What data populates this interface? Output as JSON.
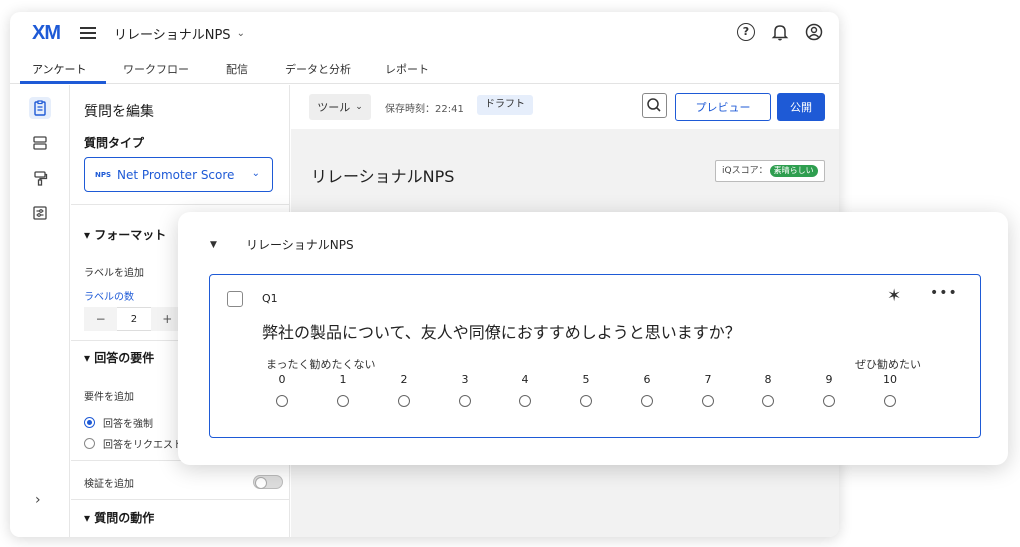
{
  "header": {
    "logo": "XM",
    "project_title": "リレーショナルNPS"
  },
  "nav_tabs": [
    "アンケート",
    "ワークフロー",
    "配信",
    "データと分析",
    "レポート"
  ],
  "edit_panel": {
    "title": "質問を編集",
    "question_type_label": "質問タイプ",
    "question_type_tag": "NPS",
    "question_type_value": "Net Promoter Score",
    "format_section": "フォーマット",
    "add_label": "ラベルを追加",
    "label_count": "ラベルの数",
    "stepper": {
      "minus": "−",
      "value": "2",
      "plus": "+"
    },
    "response_requirements": "回答の要件",
    "add_requirement": "要件を追加",
    "force_response": "回答を強制",
    "request_response": "回答をリクエスト",
    "add_validation": "検証を追加",
    "question_behavior": "質問の動作"
  },
  "toolbar": {
    "tools": "ツール",
    "save_time": "保存時刻：22:41",
    "draft": "ドラフト",
    "preview": "プレビュー",
    "publish": "公開"
  },
  "survey": {
    "title": "リレーショナルNPS",
    "iq_label": "iQスコア：",
    "iq_value": "素晴らしい"
  },
  "block": {
    "title": "リレーショナルNPS",
    "question": {
      "number": "Q1",
      "text": "弊社の製品について、友人や同僚におすすめしようと思いますか？",
      "low_anchor": "まったく勧めたくない",
      "high_anchor": "ぜひ勧めたい",
      "scale": [
        "0",
        "1",
        "2",
        "3",
        "4",
        "5",
        "6",
        "7",
        "8",
        "9",
        "10"
      ]
    }
  },
  "colors": {
    "accent": "#1e5ad6",
    "success": "#2e9e4f"
  }
}
